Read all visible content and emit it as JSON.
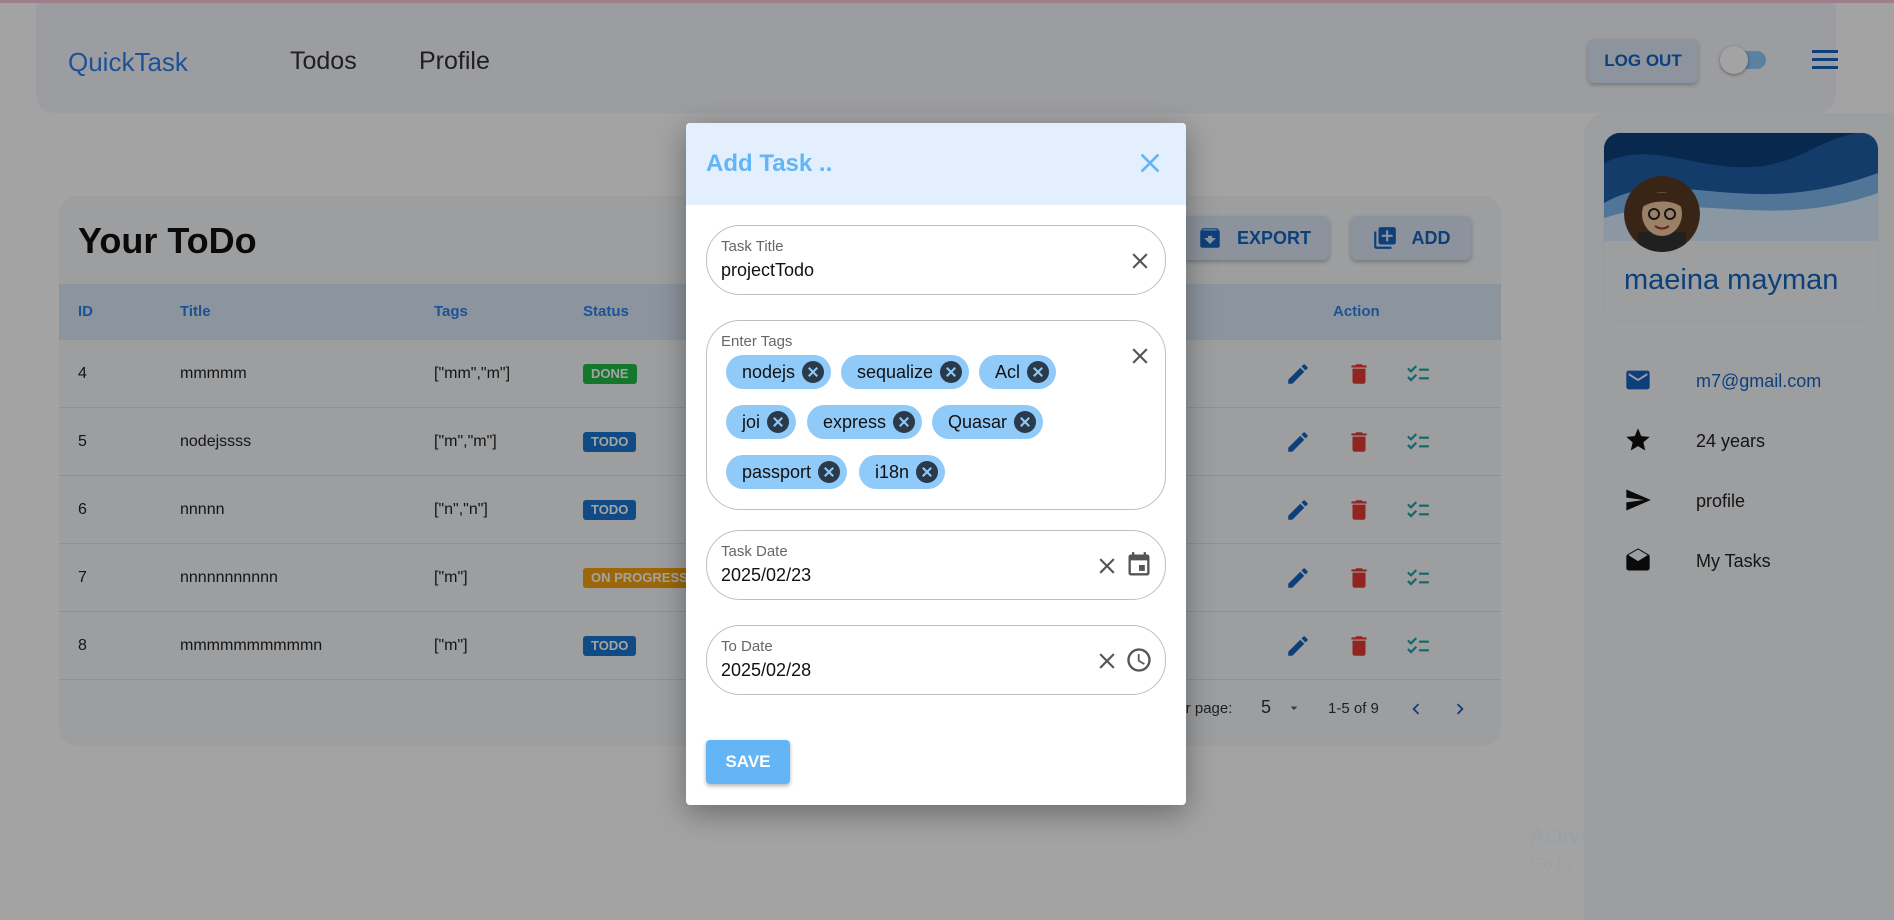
{
  "header": {
    "brand": "QuickTask",
    "nav": [
      "Todos",
      "Profile"
    ],
    "logout_label": "LOG OUT"
  },
  "todos": {
    "title": "Your ToDo",
    "export_label": "EXPORT",
    "add_label": "ADD",
    "columns": [
      "ID",
      "Title",
      "Tags",
      "Status",
      "Action"
    ],
    "rows": [
      {
        "id": "4",
        "title": "mmmmm",
        "tags": "[\"mm\",\"m\"]",
        "status": "DONE"
      },
      {
        "id": "5",
        "title": "nodejssss",
        "tags": "[\"m\",\"m\"]",
        "status": "TODO"
      },
      {
        "id": "6",
        "title": "nnnnn",
        "tags": "[\"n\",\"n\"]",
        "status": "TODO"
      },
      {
        "id": "7",
        "title": "nnnnnnnnnnn",
        "tags": "[\"m\"]",
        "status": "ON PROGRESS"
      },
      {
        "id": "8",
        "title": "mmmmmmmmmmn",
        "tags": "[\"m\"]",
        "status": "TODO"
      }
    ],
    "pagination": {
      "rows_per_page_label": "per page:",
      "rows_per_page": "5",
      "range": "1-5 of 9"
    }
  },
  "profile": {
    "name": "maeina mayman",
    "email": "m7@gmail.com",
    "age": "24 years",
    "profile_link": "profile",
    "tasks_link": "My Tasks"
  },
  "dialog": {
    "title": "Add Task ..",
    "task_title_label": "Task Title",
    "task_title_value": "projectTodo",
    "tags_label": "Enter Tags",
    "tags": [
      "nodejs",
      "sequalize",
      "Acl",
      "joi",
      "express",
      "Quasar",
      "passport",
      "i18n"
    ],
    "task_date_label": "Task Date",
    "task_date_value": "2025/02/23",
    "to_date_label": "To Date",
    "to_date_value": "2025/02/28",
    "save_label": "SAVE"
  },
  "watermark": {
    "line1": "Activate Windows",
    "line2": "Go to Settings to activate Windows."
  },
  "colors": {
    "primary": "#1565c0",
    "accent": "#64b5f6",
    "done": "#21ba45",
    "todo": "#1976d2",
    "progress": "#f2a10d",
    "delete": "#e53935",
    "chip": "#90caf9"
  }
}
